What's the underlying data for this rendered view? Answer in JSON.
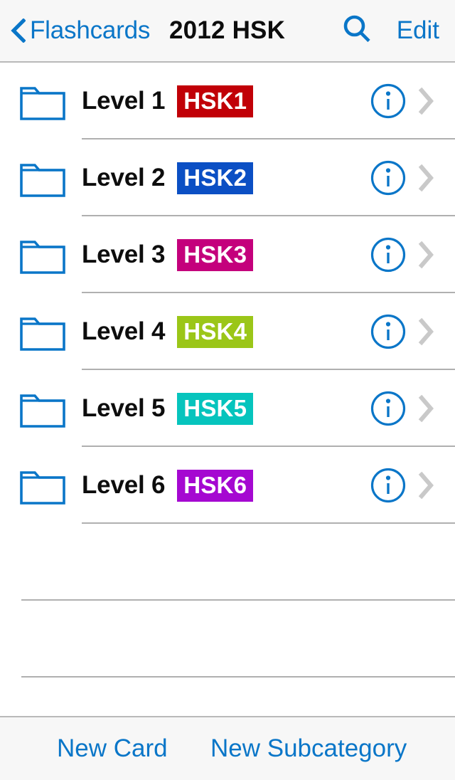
{
  "navbar": {
    "back_label": "Flashcards",
    "back_icon": "chevron-left-icon",
    "title": "2012 HSK",
    "search_icon": "search-icon",
    "edit_label": "Edit",
    "background": "#f7f7f7",
    "accent": "#0a76c8"
  },
  "list": {
    "folder_icon": "folder-icon",
    "info_icon": "info-circle-icon",
    "disclosure_icon": "chevron-right-icon",
    "rows": [
      {
        "label": "Level 1",
        "badge": "HSK1",
        "badge_color": "#c10007",
        "badge_text_color": "#ffffff"
      },
      {
        "label": "Level 2",
        "badge": "HSK2",
        "badge_color": "#0b4fc4",
        "badge_text_color": "#ffffff"
      },
      {
        "label": "Level 3",
        "badge": "HSK3",
        "badge_color": "#c4007c",
        "badge_text_color": "#ffffff"
      },
      {
        "label": "Level 4",
        "badge": "HSK4",
        "badge_color": "#9bc618",
        "badge_text_color": "#ffffff"
      },
      {
        "label": "Level 5",
        "badge": "HSK5",
        "badge_color": "#06c4bd",
        "badge_text_color": "#ffffff"
      },
      {
        "label": "Level 6",
        "badge": "HSK6",
        "badge_color": "#a508d1",
        "badge_text_color": "#ffffff"
      }
    ],
    "empty_separator_count": 2
  },
  "toolbar": {
    "new_card_label": "New Card",
    "new_subcategory_label": "New Subcategory",
    "background": "#f7f7f7",
    "accent": "#0a76c8"
  }
}
